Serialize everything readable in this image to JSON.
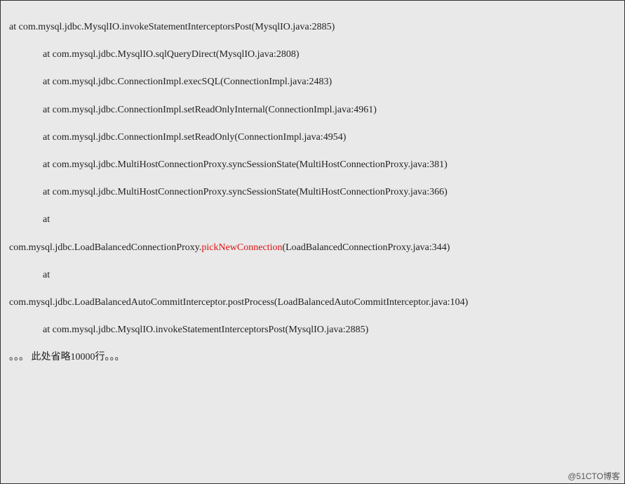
{
  "lines": {
    "l1": "at com.mysql.jdbc.MysqlIO.invokeStatementInterceptorsPost(MysqlIO.java:2885)",
    "l2": "at com.mysql.jdbc.MysqlIO.sqlQueryDirect(MysqlIO.java:2808)",
    "l3": "at com.mysql.jdbc.ConnectionImpl.execSQL(ConnectionImpl.java:2483)",
    "l4": "at com.mysql.jdbc.ConnectionImpl.setReadOnlyInternal(ConnectionImpl.java:4961)",
    "l5": "at com.mysql.jdbc.ConnectionImpl.setReadOnly(ConnectionImpl.java:4954)",
    "l6": "at com.mysql.jdbc.MultiHostConnectionProxy.syncSessionState(MultiHostConnectionProxy.java:381)",
    "l7": "at com.mysql.jdbc.MultiHostConnectionProxy.syncSessionState(MultiHostConnectionProxy.java:366)",
    "l8": "at",
    "l9_pre": "com.mysql.jdbc.LoadBalancedConnectionProxy.",
    "l9_hl": "pickNewConnection",
    "l9_post": "(LoadBalancedConnectionProxy.java:344)",
    "l10": "at",
    "l11": "com.mysql.jdbc.LoadBalancedAutoCommitInterceptor.postProcess(LoadBalancedAutoCommitInterceptor.java:104)",
    "l12": "at com.mysql.jdbc.MysqlIO.invokeStatementInterceptorsPost(MysqlIO.java:2885)",
    "ellipsis": "。。。   此处省略10000行。。。"
  },
  "watermark": "@51CTO博客"
}
